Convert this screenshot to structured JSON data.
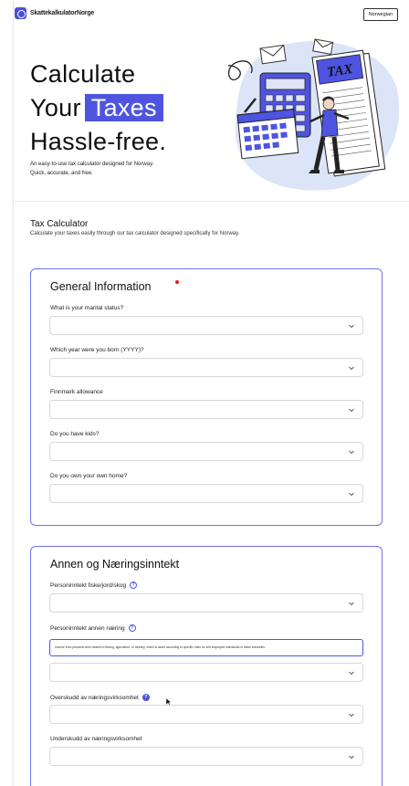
{
  "header": {
    "logo_text": "SkattekalkulatorNorge",
    "language_button": "Norwegian"
  },
  "hero": {
    "title_line1": "Calculate",
    "title_line2_prefix": "Your",
    "title_line2_highlight": "Taxes",
    "title_line3": "Hassle-free.",
    "subtitle_line1": "An easy-to-use tax calculator designed for Norway.",
    "subtitle_line2": "Quick, accurate, and free.",
    "illustration_text": "TAX"
  },
  "calculator": {
    "title": "Tax Calculator",
    "subtitle": "Calculate your taxes easily through our tax calculator designed specifically for Norway."
  },
  "general_info": {
    "title": "General Information",
    "fields": [
      {
        "label": "What is your marital status?",
        "value": ""
      },
      {
        "label": "Which year were you born (YYYY)?",
        "value": ""
      },
      {
        "label": "Finnmark allowance",
        "value": ""
      },
      {
        "label": "Do you have kids?",
        "value": ""
      },
      {
        "label": "Do you own your own home?",
        "value": ""
      }
    ]
  },
  "income": {
    "title": "Annen og Næringsinntekt",
    "fields": [
      {
        "label": "Personinntekt fiske/jord/skog",
        "value": ""
      },
      {
        "label": "Personinntekt annen næring",
        "value": ""
      },
      {
        "label": "Overskudd av næringsvirksomhet",
        "value": ""
      },
      {
        "label": "Underskudd av næringsvirksomhet",
        "value": ""
      }
    ],
    "tooltip": "Income from personal work related to fishing, agriculture, or forestry, which is taxed according to specific rules for self-employed individuals in these industries."
  },
  "colors": {
    "accent": "#4e54e0",
    "card_border": "#6f74e6",
    "dot": "#e02020"
  }
}
